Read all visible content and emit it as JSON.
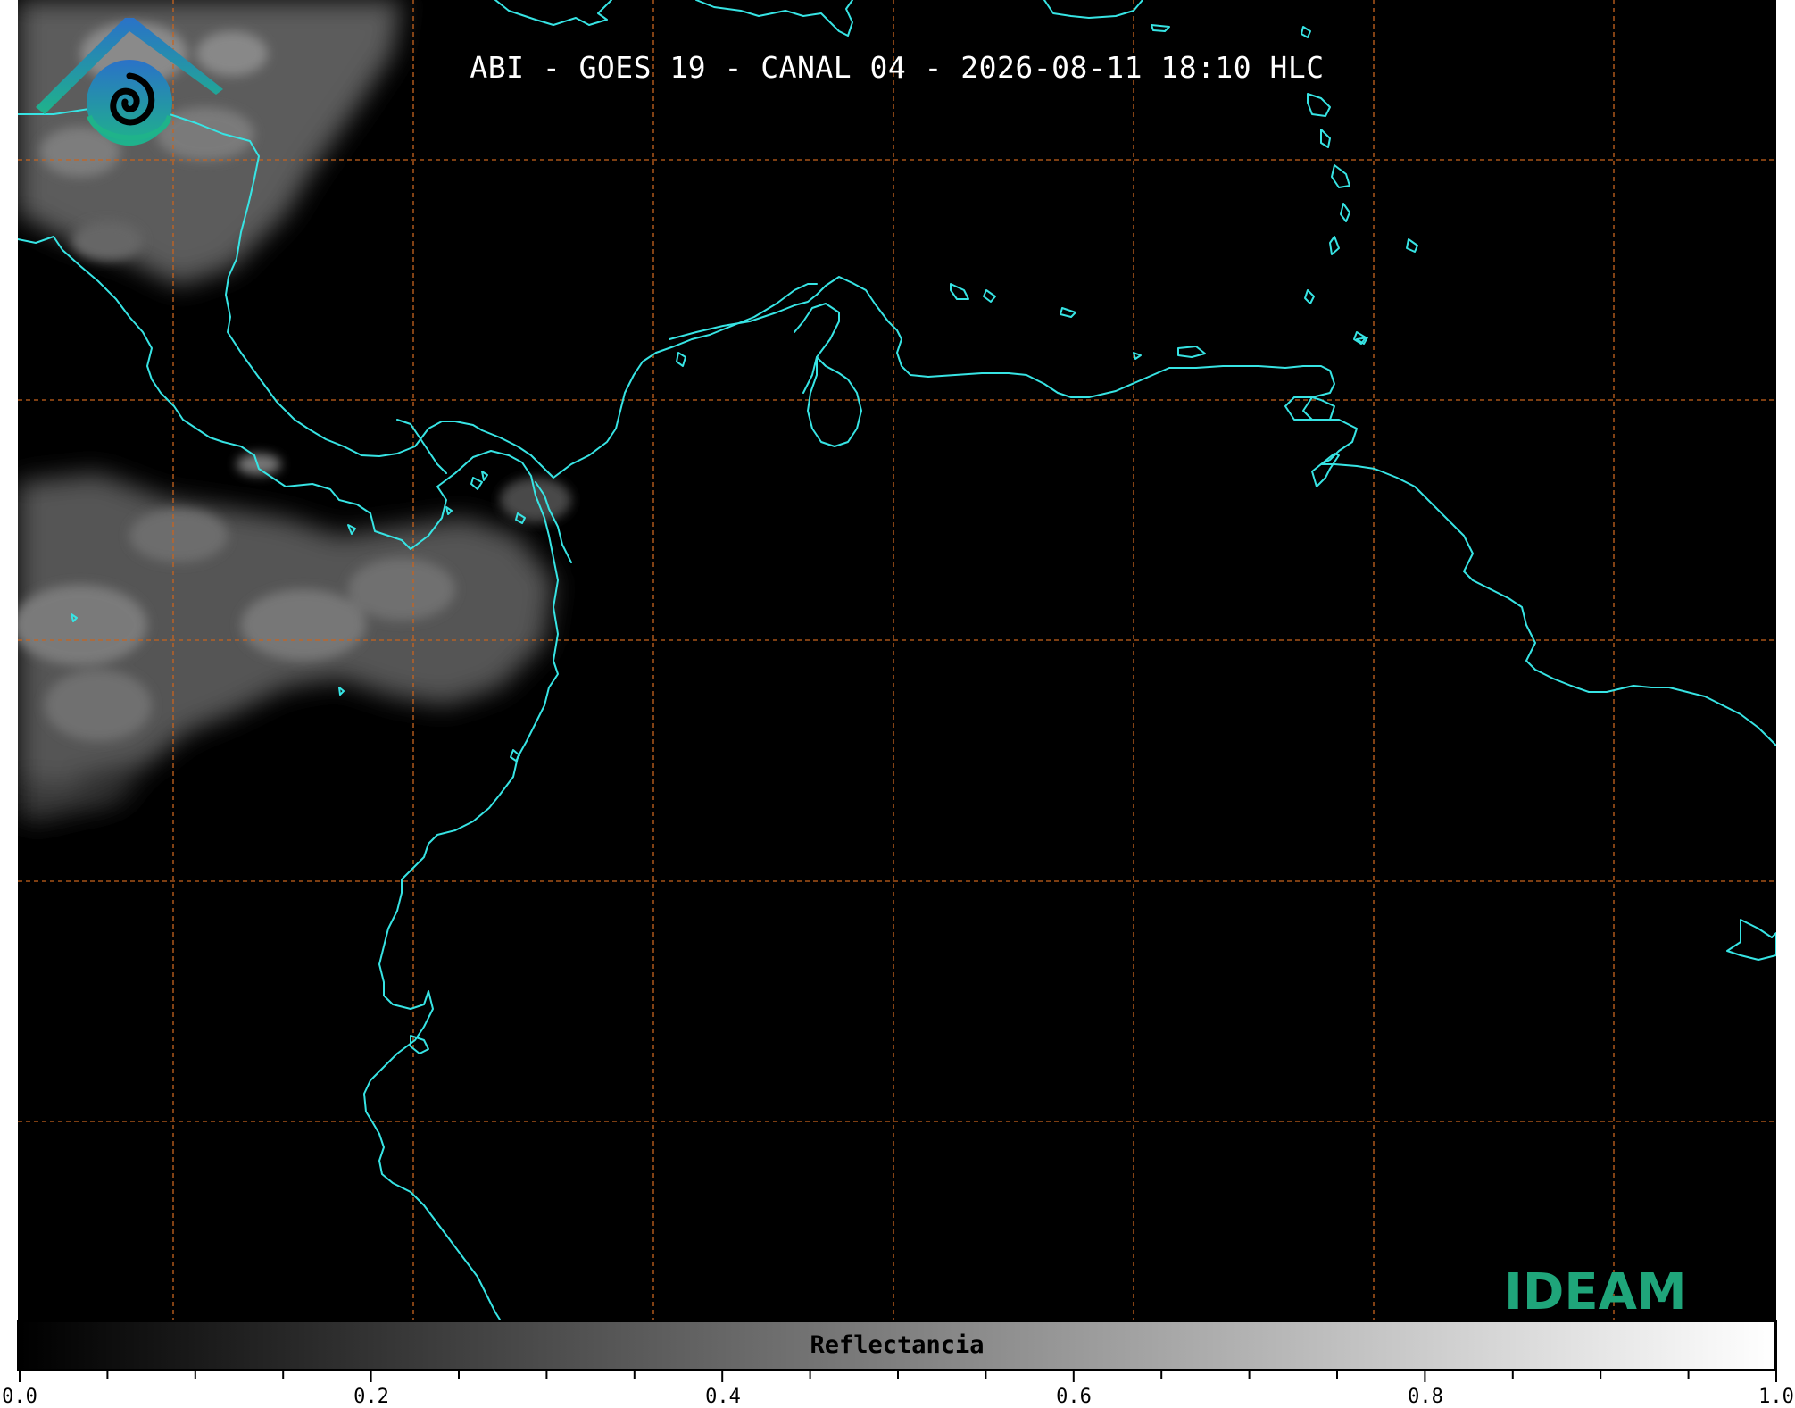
{
  "title": "ABI - GOES 19 - CANAL 04 - 2026-08-11 18:10 HLC",
  "map": {
    "background": "#000000",
    "coastline_color": "#37e4e4",
    "gridline_color": "#c8641e",
    "gridline_style": "dashed",
    "cloud_regions": [
      "northwest cloud mass",
      "central-west cloud mass over Central America",
      "southwest cloud mass"
    ]
  },
  "logo": {
    "text": "IDEAM",
    "icon": "mountain-spiral-icon",
    "color": "#1fa57a"
  },
  "colorbar": {
    "label": "Reflectancia",
    "colormap": "grayscale black-to-white",
    "range": [
      0.0,
      1.0
    ],
    "tick_labels": [
      "0.0",
      "0.2",
      "0.4",
      "0.6",
      "0.8",
      "1.0"
    ]
  }
}
